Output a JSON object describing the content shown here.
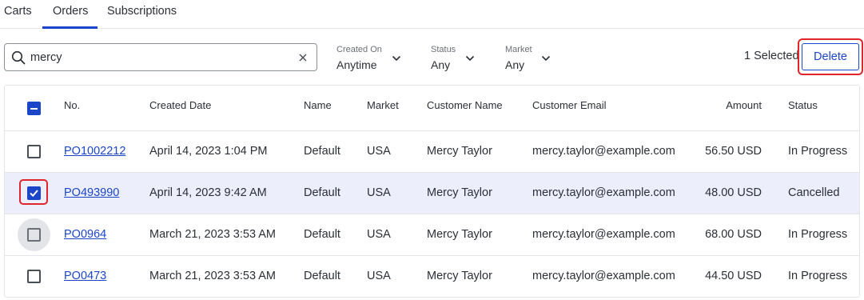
{
  "tabs": [
    {
      "label": "Carts",
      "active": false
    },
    {
      "label": "Orders",
      "active": true
    },
    {
      "label": "Subscriptions",
      "active": false
    }
  ],
  "search": {
    "value": "mercy",
    "placeholder": "Search"
  },
  "filters": [
    {
      "label": "Created On",
      "value": "Anytime"
    },
    {
      "label": "Status",
      "value": "Any"
    },
    {
      "label": "Market",
      "value": "Any"
    }
  ],
  "selection": {
    "count_text": "1 Selected"
  },
  "toolbar": {
    "delete_label": "Delete"
  },
  "colors": {
    "accent": "#1b46c9",
    "highlight": "#e0262c",
    "selected_row": "#eceefb"
  },
  "table": {
    "columns": [
      "No.",
      "Created Date",
      "Name",
      "Market",
      "Customer Name",
      "Customer Email",
      "Amount",
      "Status"
    ],
    "rows": [
      {
        "no": "PO1002212",
        "date": "April 14, 2023 1:04 PM",
        "name": "Default",
        "market": "USA",
        "customer": "Mercy Taylor",
        "email": "mercy.taylor@example.com",
        "amount": "56.50 USD",
        "status": "In Progress",
        "checked": false
      },
      {
        "no": "PO493990",
        "date": "April 14, 2023 9:42 AM",
        "name": "Default",
        "market": "USA",
        "customer": "Mercy Taylor",
        "email": "mercy.taylor@example.com",
        "amount": "48.00 USD",
        "status": "Cancelled",
        "checked": true
      },
      {
        "no": "PO0964",
        "date": "March 21, 2023 3:53 AM",
        "name": "Default",
        "market": "USA",
        "customer": "Mercy Taylor",
        "email": "mercy.taylor@example.com",
        "amount": "68.00 USD",
        "status": "In Progress",
        "checked": false
      },
      {
        "no": "PO0473",
        "date": "March 21, 2023 3:53 AM",
        "name": "Default",
        "market": "USA",
        "customer": "Mercy Taylor",
        "email": "mercy.taylor@example.com",
        "amount": "44.50 USD",
        "status": "In Progress",
        "checked": false
      }
    ]
  }
}
